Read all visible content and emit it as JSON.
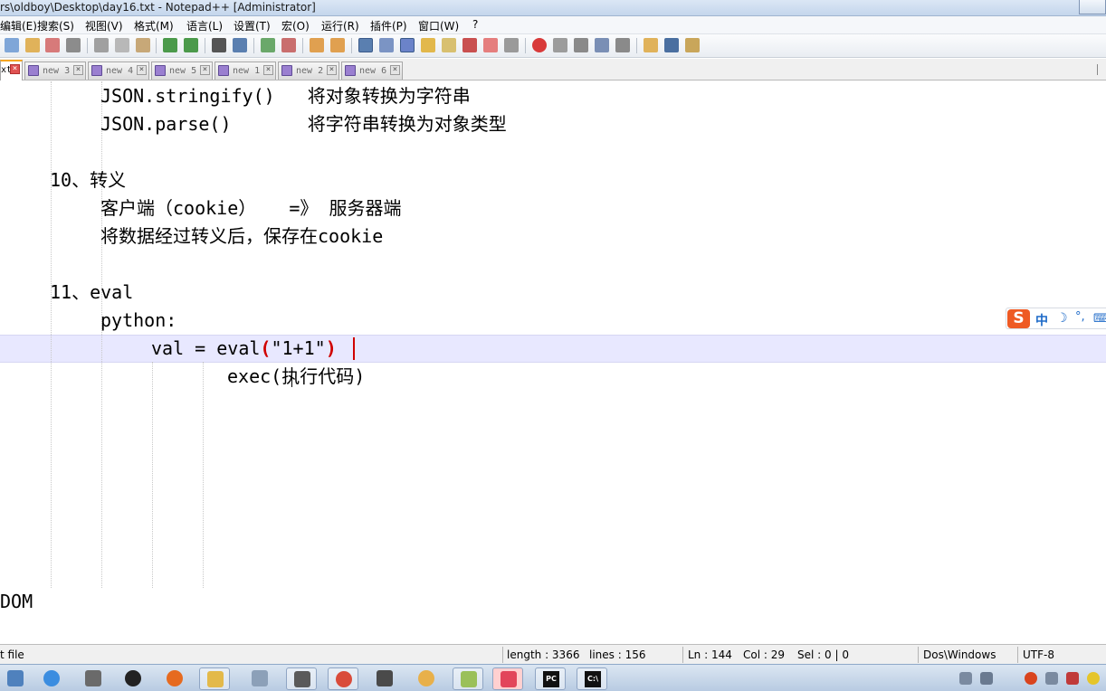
{
  "window": {
    "title": "rs\\oldboy\\Desktop\\day16.txt - Notepad++ [Administrator]"
  },
  "menu": {
    "items": [
      "编辑(E)",
      "搜索(S)",
      "视图(V)",
      "格式(M)",
      "语言(L)",
      "设置(T)",
      "宏(O)",
      "运行(R)",
      "插件(P)",
      "窗口(W)",
      "?"
    ]
  },
  "toolbar": {
    "icons": [
      "new-file-icon",
      "open-file-icon",
      "save-icon",
      "save-all-icon",
      "close-icon",
      "print-icon",
      "cut-icon",
      "copy-icon",
      "paste-icon",
      "undo-icon",
      "redo-icon",
      "find-icon",
      "replace-icon",
      "zoom-in-icon",
      "zoom-out-icon",
      "sync-v-icon",
      "sync-h-icon",
      "word-wrap-icon",
      "show-all-chars-icon",
      "indent-guide-icon",
      "user-lang-icon",
      "doc-map-icon",
      "function-list-icon",
      "folder-workspace-icon",
      "monitor-icon",
      "record-macro-icon",
      "stop-macro-icon",
      "play-macro-icon",
      "run-macro-multiple-icon",
      "save-macro-icon",
      "open-folder-icon",
      "console-icon",
      "plugin-icon"
    ]
  },
  "tabs": [
    {
      "label": "xt",
      "active": true
    },
    {
      "label": "new 3",
      "active": false
    },
    {
      "label": "new 4",
      "active": false
    },
    {
      "label": "new 5",
      "active": false
    },
    {
      "label": "new 1",
      "active": false
    },
    {
      "label": "new 2",
      "active": false
    },
    {
      "label": "new 6",
      "active": false
    }
  ],
  "tab_close_glyph": "×",
  "editor": {
    "lines": [
      {
        "text": "JSON.stringify()   将对象转换为字符串"
      },
      {
        "text": "JSON.parse()       将字符串转换为对象类型"
      },
      {
        "text": "10、转义"
      },
      {
        "text": "客户端（cookie）   =》 服务器端"
      },
      {
        "text": "将数据经过转义后，保存在cookie"
      },
      {
        "text": "11、eval"
      },
      {
        "text": "python:"
      },
      {
        "pre": "val = eval",
        "open": "(",
        "mid": "\"1+1\"",
        "close": ")"
      },
      {
        "text": "exec(执行代码)"
      },
      {
        "text": "DOM"
      }
    ]
  },
  "ime": {
    "logo": "S",
    "mode": "中",
    "moon": "☽",
    "punct": "°,",
    "keyboard": "⌨"
  },
  "status": {
    "type": "t file",
    "length": "length : 3366",
    "lines": "lines : 156",
    "ln": "Ln : 144",
    "col": "Col : 29",
    "sel": "Sel : 0 | 0",
    "eol": "Dos\\Windows",
    "encoding": "UTF-8"
  },
  "taskbar": {
    "apps": [
      "start-icon",
      "ie-icon",
      "network-icon",
      "qq-icon",
      "firefox-icon",
      "explorer-icon",
      "search-app-icon",
      "news-icon",
      "chrome-icon",
      "tool-icon",
      "paint-icon",
      "notepadpp-icon",
      "pocket-icon",
      "pycharm-icon",
      "cmd-icon"
    ],
    "pycharm_label": "PC",
    "cmd_label": "C:\\"
  },
  "colors": {
    "current_line": "#e8e8ff",
    "brace_match": "#d00000",
    "active_tab_accent": "#f5a623"
  }
}
